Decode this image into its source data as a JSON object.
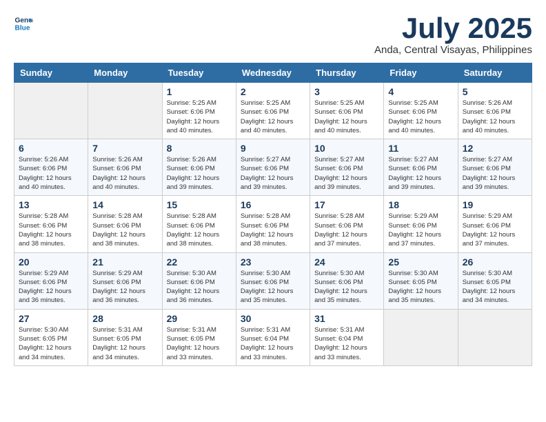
{
  "logo": {
    "line1": "General",
    "line2": "Blue"
  },
  "title": "July 2025",
  "location": "Anda, Central Visayas, Philippines",
  "days_of_week": [
    "Sunday",
    "Monday",
    "Tuesday",
    "Wednesday",
    "Thursday",
    "Friday",
    "Saturday"
  ],
  "weeks": [
    [
      {
        "day": "",
        "info": ""
      },
      {
        "day": "",
        "info": ""
      },
      {
        "day": "1",
        "info": "Sunrise: 5:25 AM\nSunset: 6:06 PM\nDaylight: 12 hours\nand 40 minutes."
      },
      {
        "day": "2",
        "info": "Sunrise: 5:25 AM\nSunset: 6:06 PM\nDaylight: 12 hours\nand 40 minutes."
      },
      {
        "day": "3",
        "info": "Sunrise: 5:25 AM\nSunset: 6:06 PM\nDaylight: 12 hours\nand 40 minutes."
      },
      {
        "day": "4",
        "info": "Sunrise: 5:25 AM\nSunset: 6:06 PM\nDaylight: 12 hours\nand 40 minutes."
      },
      {
        "day": "5",
        "info": "Sunrise: 5:26 AM\nSunset: 6:06 PM\nDaylight: 12 hours\nand 40 minutes."
      }
    ],
    [
      {
        "day": "6",
        "info": "Sunrise: 5:26 AM\nSunset: 6:06 PM\nDaylight: 12 hours\nand 40 minutes."
      },
      {
        "day": "7",
        "info": "Sunrise: 5:26 AM\nSunset: 6:06 PM\nDaylight: 12 hours\nand 40 minutes."
      },
      {
        "day": "8",
        "info": "Sunrise: 5:26 AM\nSunset: 6:06 PM\nDaylight: 12 hours\nand 39 minutes."
      },
      {
        "day": "9",
        "info": "Sunrise: 5:27 AM\nSunset: 6:06 PM\nDaylight: 12 hours\nand 39 minutes."
      },
      {
        "day": "10",
        "info": "Sunrise: 5:27 AM\nSunset: 6:06 PM\nDaylight: 12 hours\nand 39 minutes."
      },
      {
        "day": "11",
        "info": "Sunrise: 5:27 AM\nSunset: 6:06 PM\nDaylight: 12 hours\nand 39 minutes."
      },
      {
        "day": "12",
        "info": "Sunrise: 5:27 AM\nSunset: 6:06 PM\nDaylight: 12 hours\nand 39 minutes."
      }
    ],
    [
      {
        "day": "13",
        "info": "Sunrise: 5:28 AM\nSunset: 6:06 PM\nDaylight: 12 hours\nand 38 minutes."
      },
      {
        "day": "14",
        "info": "Sunrise: 5:28 AM\nSunset: 6:06 PM\nDaylight: 12 hours\nand 38 minutes."
      },
      {
        "day": "15",
        "info": "Sunrise: 5:28 AM\nSunset: 6:06 PM\nDaylight: 12 hours\nand 38 minutes."
      },
      {
        "day": "16",
        "info": "Sunrise: 5:28 AM\nSunset: 6:06 PM\nDaylight: 12 hours\nand 38 minutes."
      },
      {
        "day": "17",
        "info": "Sunrise: 5:28 AM\nSunset: 6:06 PM\nDaylight: 12 hours\nand 37 minutes."
      },
      {
        "day": "18",
        "info": "Sunrise: 5:29 AM\nSunset: 6:06 PM\nDaylight: 12 hours\nand 37 minutes."
      },
      {
        "day": "19",
        "info": "Sunrise: 5:29 AM\nSunset: 6:06 PM\nDaylight: 12 hours\nand 37 minutes."
      }
    ],
    [
      {
        "day": "20",
        "info": "Sunrise: 5:29 AM\nSunset: 6:06 PM\nDaylight: 12 hours\nand 36 minutes."
      },
      {
        "day": "21",
        "info": "Sunrise: 5:29 AM\nSunset: 6:06 PM\nDaylight: 12 hours\nand 36 minutes."
      },
      {
        "day": "22",
        "info": "Sunrise: 5:30 AM\nSunset: 6:06 PM\nDaylight: 12 hours\nand 36 minutes."
      },
      {
        "day": "23",
        "info": "Sunrise: 5:30 AM\nSunset: 6:06 PM\nDaylight: 12 hours\nand 35 minutes."
      },
      {
        "day": "24",
        "info": "Sunrise: 5:30 AM\nSunset: 6:06 PM\nDaylight: 12 hours\nand 35 minutes."
      },
      {
        "day": "25",
        "info": "Sunrise: 5:30 AM\nSunset: 6:05 PM\nDaylight: 12 hours\nand 35 minutes."
      },
      {
        "day": "26",
        "info": "Sunrise: 5:30 AM\nSunset: 6:05 PM\nDaylight: 12 hours\nand 34 minutes."
      }
    ],
    [
      {
        "day": "27",
        "info": "Sunrise: 5:30 AM\nSunset: 6:05 PM\nDaylight: 12 hours\nand 34 minutes."
      },
      {
        "day": "28",
        "info": "Sunrise: 5:31 AM\nSunset: 6:05 PM\nDaylight: 12 hours\nand 34 minutes."
      },
      {
        "day": "29",
        "info": "Sunrise: 5:31 AM\nSunset: 6:05 PM\nDaylight: 12 hours\nand 33 minutes."
      },
      {
        "day": "30",
        "info": "Sunrise: 5:31 AM\nSunset: 6:04 PM\nDaylight: 12 hours\nand 33 minutes."
      },
      {
        "day": "31",
        "info": "Sunrise: 5:31 AM\nSunset: 6:04 PM\nDaylight: 12 hours\nand 33 minutes."
      },
      {
        "day": "",
        "info": ""
      },
      {
        "day": "",
        "info": ""
      }
    ]
  ]
}
